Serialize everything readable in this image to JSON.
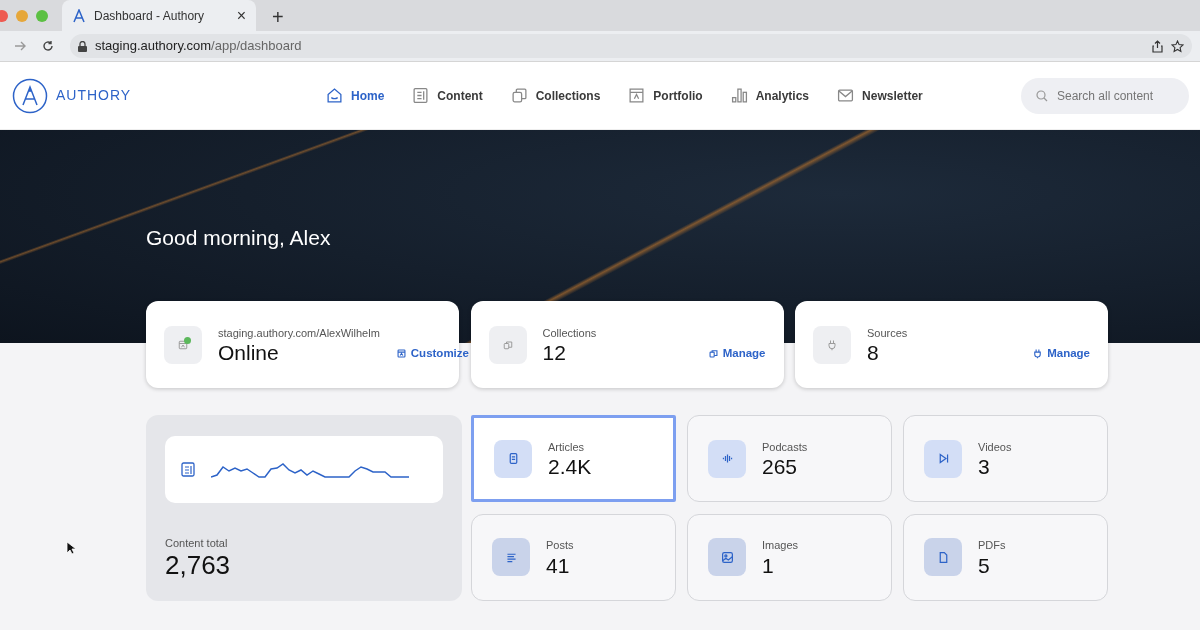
{
  "browser": {
    "tab_title": "Dashboard - Authory",
    "tab_close": "×",
    "new_tab": "+",
    "url_host": "staging.authory.com",
    "url_path": "/app/dashboard"
  },
  "header": {
    "brand": "AUTHORY",
    "search": {
      "placeholder": "Search all content"
    },
    "nav": [
      {
        "label": "Home",
        "selected": true
      },
      {
        "label": "Content",
        "selected": false
      },
      {
        "label": "Collections",
        "selected": false
      },
      {
        "label": "Portfolio",
        "selected": false
      },
      {
        "label": "Analytics",
        "selected": false
      },
      {
        "label": "Newsletter",
        "selected": false
      }
    ]
  },
  "hero": {
    "greeting": "Good morning, Alex"
  },
  "summary_cards": [
    {
      "label": "staging.authory.com/AlexWilhelm",
      "value": "Online",
      "action": "Customize",
      "online": true
    },
    {
      "label": "Collections",
      "value": "12",
      "action": "Manage",
      "online": false
    },
    {
      "label": "Sources",
      "value": "8",
      "action": "Manage",
      "online": false
    }
  ],
  "content_total": {
    "label": "Content total",
    "value": "2,763"
  },
  "content_types": [
    {
      "label": "Articles",
      "value": "2.4K",
      "selected": true
    },
    {
      "label": "Podcasts",
      "value": "265",
      "selected": false
    },
    {
      "label": "Videos",
      "value": "3",
      "selected": false
    },
    {
      "label": "Posts",
      "value": "41",
      "selected": false
    },
    {
      "label": "Images",
      "value": "1",
      "selected": false
    },
    {
      "label": "PDFs",
      "value": "5",
      "selected": false
    }
  ]
}
